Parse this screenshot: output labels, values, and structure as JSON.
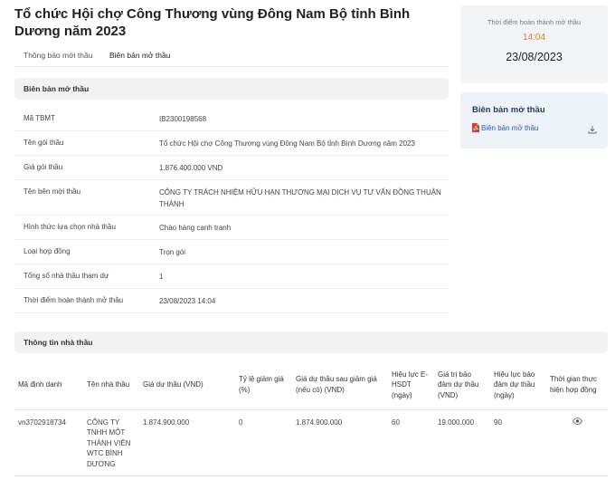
{
  "page": {
    "title": "Tổ chức Hội chợ Công Thương vùng Đông Nam Bộ tỉnh Bình Dương năm 2023"
  },
  "tabs": [
    {
      "label": "Thông báo mời thầu"
    },
    {
      "label": "Biên bản mở thầu"
    }
  ],
  "opening_report": {
    "header": "Biên bản mở thầu",
    "rows": [
      {
        "key": "Mã TBMT",
        "value": "IB2300198568"
      },
      {
        "key": "Tên gói thầu",
        "value": "Tổ chức Hội chợ Công Thương vùng Đông Nam Bộ tỉnh Bình Dương năm 2023"
      },
      {
        "key": "Giá gói thầu",
        "value": "1.876.400.000 VND"
      },
      {
        "key": "Tên bên mời thầu",
        "value": "CÔNG TY TRÁCH NHIỆM HỮU HẠN THƯƠNG MẠI DỊCH VỤ TƯ VẤN ĐỒNG THUẬN THÀNH"
      },
      {
        "key": "Hình thức lựa chọn nhà thầu",
        "value": "Chào hàng cạnh tranh"
      },
      {
        "key": "Loại hợp đồng",
        "value": "Trọn gói"
      },
      {
        "key": "Tổng số nhà thầu tham dự",
        "value": "1"
      },
      {
        "key": "Thời điểm hoàn thành mở thầu",
        "value": "23/08/2023 14:04"
      }
    ]
  },
  "completion_card": {
    "label": "Thời điểm hoàn thành mở thầu",
    "time": "14:04",
    "date": "23/08/2023"
  },
  "attachment_card": {
    "header": "Biên bản mở thầu",
    "file_label": "Biên bản mở thầu",
    "file_icon": "pdf-icon",
    "download_icon": "download-icon"
  },
  "contractor_info": {
    "header": "Thông tin nhà thầu",
    "columns": [
      "Mã định danh",
      "Tên nhà thầu",
      "Giá dự thầu (VND)",
      "Tỷ lệ giảm giá (%)",
      "Giá dự thầu sau giảm giá (nếu có) (VND)",
      "Hiệu lực E-HSDT (ngày)",
      "Giá trị bảo đảm dự thầu (VND)",
      "Hiệu lực bảo đảm dự thầu (ngày)",
      "Thời gian thực hiện hợp đồng"
    ],
    "rows": [
      {
        "id": "vn3702918734",
        "name": "CÔNG TY TNHH MỘT THÀNH VIÊN WTC BÌNH DƯƠNG",
        "bid_price": "1.874.900.000",
        "discount_rate": "0",
        "price_after_discount": "1.874.900.000",
        "validity": "60",
        "guarantee_value": "19.000.000",
        "guarantee_validity": "90",
        "duration_icon": "eye-icon"
      }
    ]
  },
  "colors": {
    "accent_time": "#d1822b",
    "link": "#2559b6",
    "card_bg": "#f3f4f6",
    "attachment_bg": "#eef3fa"
  }
}
